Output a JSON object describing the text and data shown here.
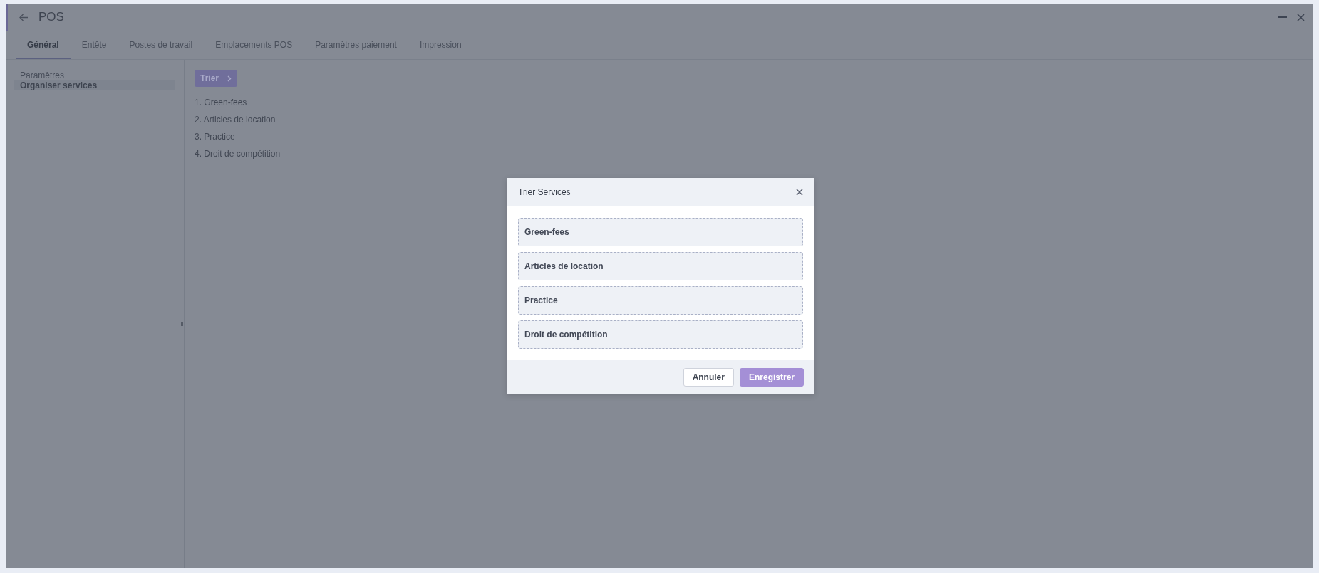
{
  "window": {
    "title": "POS"
  },
  "tabs": [
    {
      "label": "Général",
      "selected": true
    },
    {
      "label": "Entête",
      "selected": false
    },
    {
      "label": "Postes de travail",
      "selected": false
    },
    {
      "label": "Emplacements POS",
      "selected": false
    },
    {
      "label": "Paramètres paiement",
      "selected": false
    },
    {
      "label": "Impression",
      "selected": false
    }
  ],
  "sidebar": {
    "items": [
      {
        "label": "Paramètres",
        "selected": false
      },
      {
        "label": "Organiser services",
        "selected": true
      }
    ]
  },
  "sort_button": {
    "label": "Trier"
  },
  "services": [
    "1. Green-fees",
    "2. Articles de location",
    "3. Practice",
    "4. Droit de compétition"
  ],
  "dialog": {
    "title": "Trier Services",
    "items": [
      "Green-fees",
      "Articles de location",
      "Practice",
      "Droit de compétition"
    ],
    "buttons": [
      {
        "label": "Annuler",
        "kind": "secondary"
      },
      {
        "label": "Enregistrer",
        "kind": "primary"
      }
    ]
  }
}
